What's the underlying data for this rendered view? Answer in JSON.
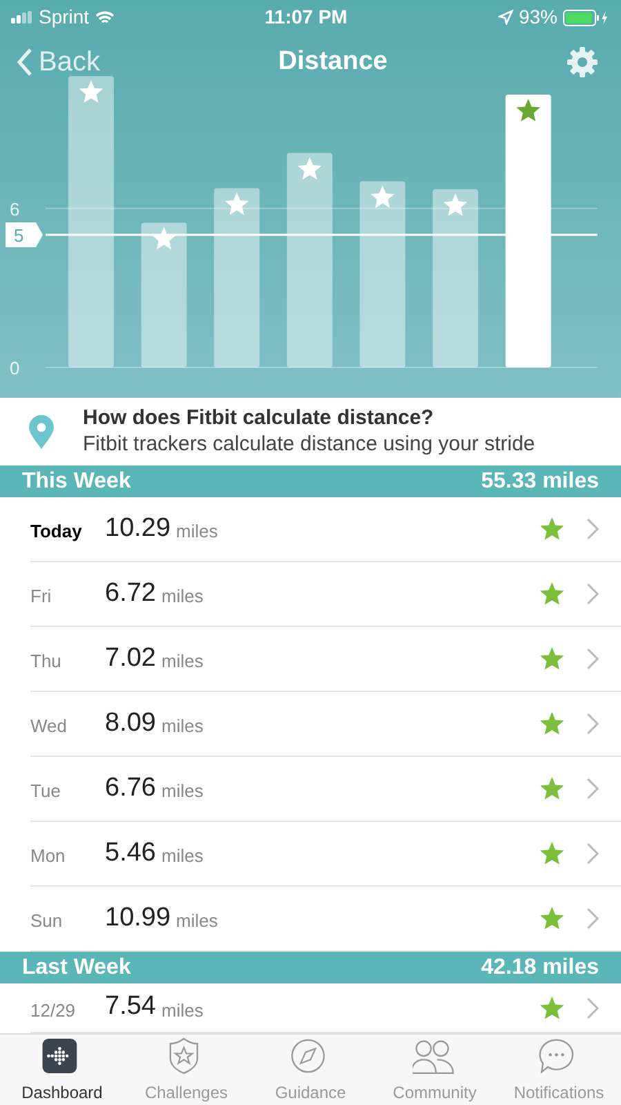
{
  "status_bar": {
    "carrier": "Sprint",
    "time": "11:07 PM",
    "battery": "93%"
  },
  "header": {
    "back": "Back",
    "title": "Distance"
  },
  "chart_data": {
    "type": "bar",
    "values": [
      10.99,
      5.46,
      6.76,
      8.09,
      7.02,
      6.72,
      10.29
    ],
    "ylim": [
      0,
      11.1
    ],
    "yticks": [
      0,
      6
    ],
    "ref_lines": [
      {
        "axis": "y",
        "value": 5,
        "label": "5"
      }
    ]
  },
  "info": {
    "title": "How does Fitbit calculate distance?",
    "text": "Fitbit trackers calculate distance using your stride"
  },
  "sections": [
    {
      "title": "This Week",
      "total": "55.33 miles",
      "rows": [
        {
          "day": "Today",
          "current": true,
          "value": "10.29",
          "unit": "miles",
          "goal_met": true
        },
        {
          "day": "Fri",
          "current": false,
          "value": "6.72",
          "unit": "miles",
          "goal_met": true
        },
        {
          "day": "Thu",
          "current": false,
          "value": "7.02",
          "unit": "miles",
          "goal_met": true
        },
        {
          "day": "Wed",
          "current": false,
          "value": "8.09",
          "unit": "miles",
          "goal_met": true
        },
        {
          "day": "Tue",
          "current": false,
          "value": "6.76",
          "unit": "miles",
          "goal_met": true
        },
        {
          "day": "Mon",
          "current": false,
          "value": "5.46",
          "unit": "miles",
          "goal_met": true
        },
        {
          "day": "Sun",
          "current": false,
          "value": "10.99",
          "unit": "miles",
          "goal_met": true
        }
      ]
    },
    {
      "title": "Last Week",
      "total": "42.18 miles",
      "rows": [
        {
          "day": "12/29",
          "current": false,
          "value": "7.54",
          "unit": "miles",
          "goal_met": true
        }
      ]
    }
  ],
  "tabs": [
    {
      "label": "Dashboard",
      "kind": "dashboard",
      "selected": true
    },
    {
      "label": "Challenges",
      "kind": "challenges",
      "selected": false
    },
    {
      "label": "Guidance",
      "kind": "guidance",
      "selected": false
    },
    {
      "label": "Community",
      "kind": "community",
      "selected": false
    },
    {
      "label": "Notifications",
      "kind": "notifications",
      "selected": false
    }
  ]
}
